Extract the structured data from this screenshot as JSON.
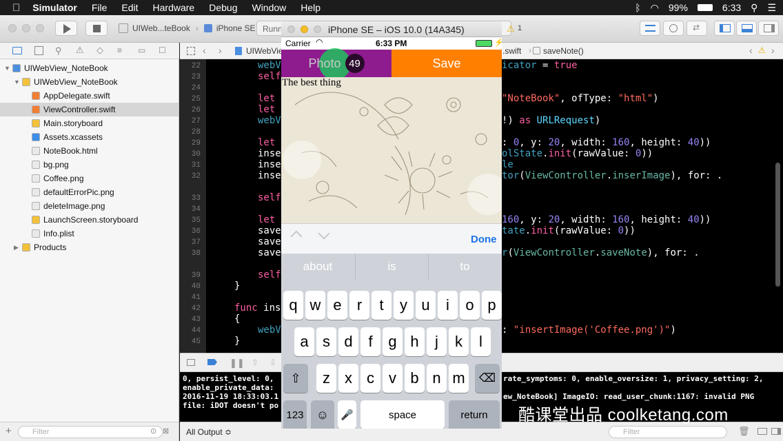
{
  "menubar": {
    "app": "Simulator",
    "items": [
      "File",
      "Edit",
      "Hardware",
      "Debug",
      "Window",
      "Help"
    ],
    "battery": "99%",
    "time": "6:33"
  },
  "toolbar": {
    "scheme": "UIWeb...teBook",
    "device": "iPhone SE",
    "status": "Runni",
    "warnings": "1"
  },
  "navigator": {
    "items": [
      {
        "label": "UIWebView_NoteBook",
        "indent": 0,
        "icon": "project-icon",
        "disclosure": "▼"
      },
      {
        "label": "UIWebView_NoteBook",
        "indent": 1,
        "icon": "folder-icon",
        "disclosure": "▼"
      },
      {
        "label": "AppDelegate.swift",
        "indent": 2,
        "icon": "swift-file-icon",
        "disclosure": ""
      },
      {
        "label": "ViewController.swift",
        "indent": 2,
        "icon": "swift-file-icon",
        "disclosure": "",
        "selected": true
      },
      {
        "label": "Main.storyboard",
        "indent": 2,
        "icon": "storyboard-icon",
        "disclosure": ""
      },
      {
        "label": "Assets.xcassets",
        "indent": 2,
        "icon": "assets-icon",
        "disclosure": ""
      },
      {
        "label": "NoteBook.html",
        "indent": 2,
        "icon": "html-file-icon",
        "disclosure": ""
      },
      {
        "label": "bg.png",
        "indent": 2,
        "icon": "image-file-icon",
        "disclosure": ""
      },
      {
        "label": "Coffee.png",
        "indent": 2,
        "icon": "image-file-icon",
        "disclosure": ""
      },
      {
        "label": "defaultErrorPic.png",
        "indent": 2,
        "icon": "image-file-icon",
        "disclosure": ""
      },
      {
        "label": "deleteImage.png",
        "indent": 2,
        "icon": "image-file-icon",
        "disclosure": ""
      },
      {
        "label": "LaunchScreen.storyboard",
        "indent": 2,
        "icon": "storyboard-icon",
        "disclosure": ""
      },
      {
        "label": "Info.plist",
        "indent": 2,
        "icon": "plist-icon",
        "disclosure": ""
      },
      {
        "label": "Products",
        "indent": 1,
        "icon": "folder-icon",
        "disclosure": "▶"
      }
    ],
    "filter_placeholder": "Filter"
  },
  "jumpbar": {
    "left": "UIWebVie",
    "right_file": ".swift",
    "method": "saveNote()"
  },
  "editor": {
    "line_numbers": [
      "22",
      "23",
      "24",
      "25",
      "26",
      "27",
      "28",
      "29",
      "30",
      "31",
      "32",
      "33",
      "34",
      "35",
      "36",
      "37",
      "38",
      "39",
      "40",
      "41",
      "42",
      "43",
      "44",
      "45"
    ]
  },
  "console": {
    "lines": [
      "0, persist_level: 0,",
      "enable_private_data:",
      "2016-11-19 18:33:03.1",
      "file: iDOT doesn't po"
    ],
    "right_lines": [
      "rate_symptoms: 0, enable_oversize: 1, privacy_setting: 2,",
      "",
      "ew_NoteBook] ImageIO: read_user_chunk:1167: invalid PNG",
      ""
    ]
  },
  "bottombar": {
    "output": "All Output ≎",
    "filter_placeholder": "Filter"
  },
  "simulator": {
    "title": "iPhone SE – iOS 10.0 (14A345)",
    "carrier": "Carrier",
    "time": "6:33 PM"
  },
  "app": {
    "photo_label": "Photo",
    "badge": "49",
    "save_label": "Save",
    "text": "The best thing"
  },
  "keyboard": {
    "done": "Done",
    "predictions": [
      "about",
      "is",
      "to"
    ],
    "row1": [
      "q",
      "w",
      "e",
      "r",
      "t",
      "y",
      "u",
      "i",
      "o",
      "p"
    ],
    "row2": [
      "a",
      "s",
      "d",
      "f",
      "g",
      "h",
      "j",
      "k",
      "l"
    ],
    "row3": [
      "z",
      "x",
      "c",
      "v",
      "b",
      "n",
      "m"
    ],
    "numbers": "123",
    "space": "space",
    "return": "return"
  },
  "watermark": "酷课堂出品 coolketang.com"
}
